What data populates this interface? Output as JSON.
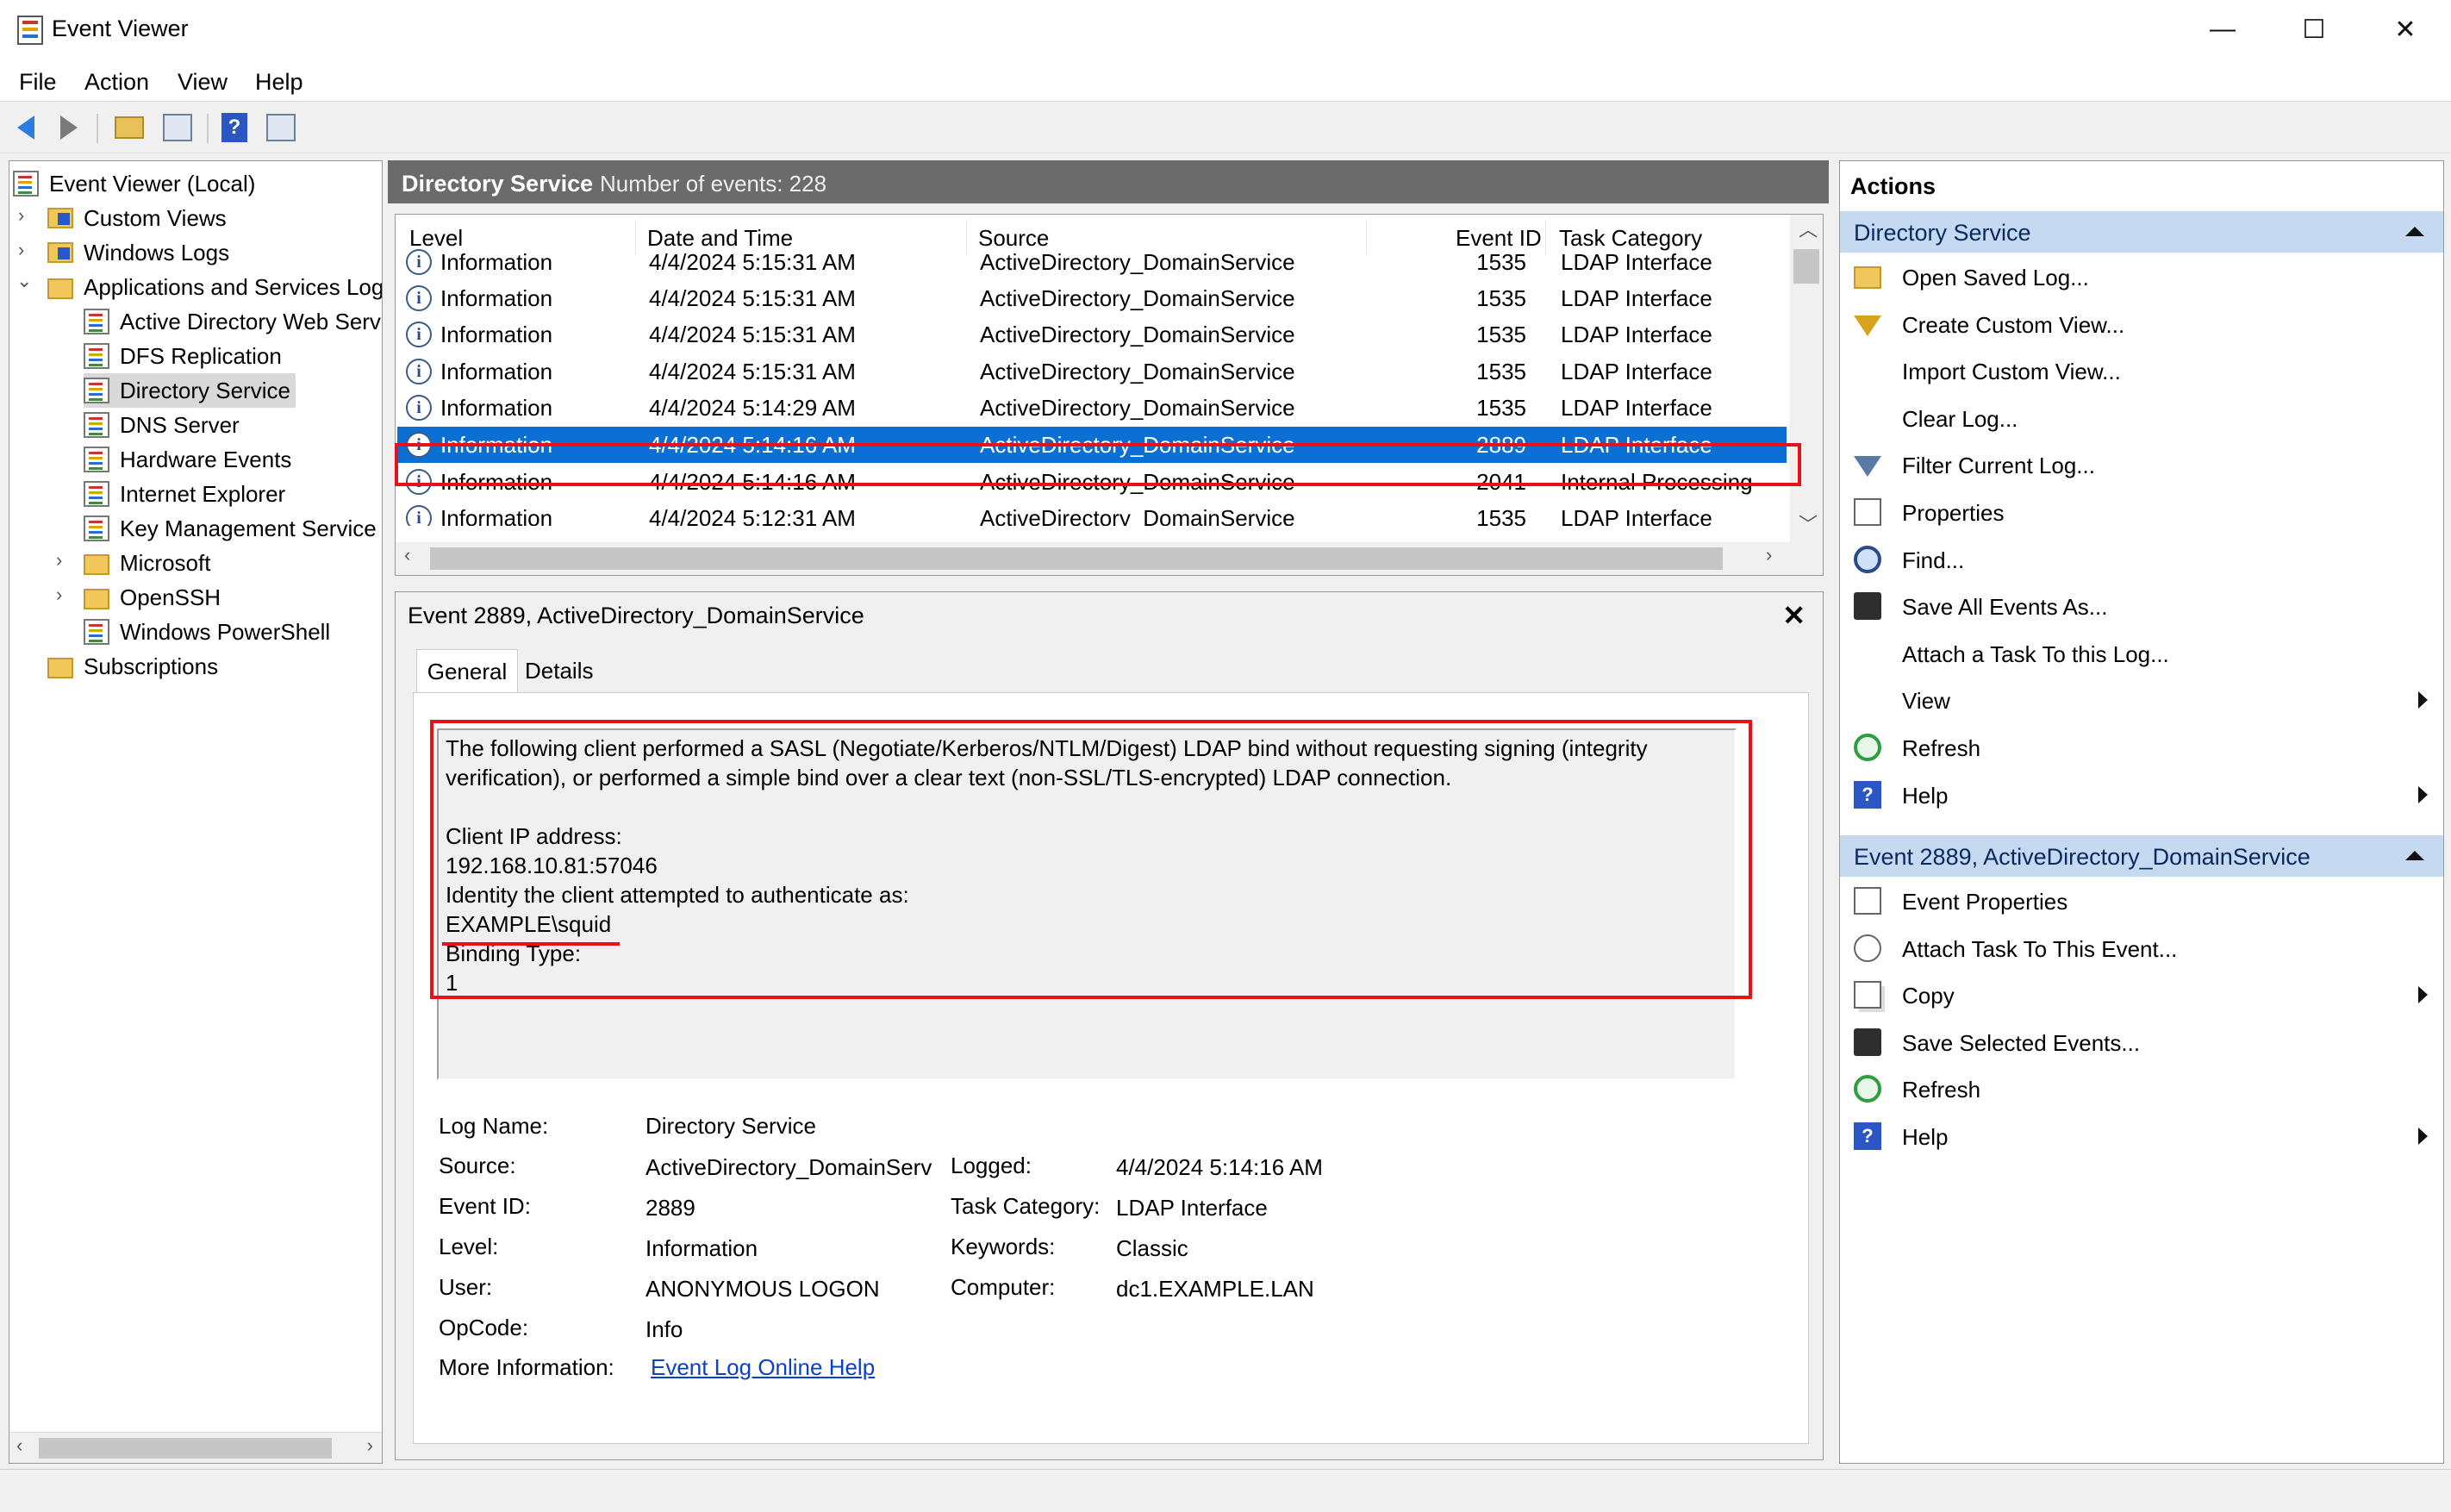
{
  "window": {
    "title": "Event Viewer",
    "minimize": "—",
    "maximize": "☐",
    "close": "✕"
  },
  "menu": [
    "File",
    "Action",
    "View",
    "Help"
  ],
  "tree": [
    {
      "label": "Event Viewer (Local)",
      "icon": "log-icon",
      "indent": 0,
      "expander": ""
    },
    {
      "label": "Custom Views",
      "icon": "folder-icon",
      "indent": 1,
      "expander": "›"
    },
    {
      "label": "Windows Logs",
      "icon": "folder-icon",
      "indent": 1,
      "expander": "›"
    },
    {
      "label": "Applications and Services Logs",
      "icon": "folder-icon",
      "indent": 1,
      "expander": "⌄"
    },
    {
      "label": "Active Directory Web Services",
      "icon": "log-icon",
      "indent": 2,
      "expander": ""
    },
    {
      "label": "DFS Replication",
      "icon": "log-icon",
      "indent": 2,
      "expander": ""
    },
    {
      "label": "Directory Service",
      "icon": "log-icon",
      "indent": 2,
      "expander": "",
      "selected": true
    },
    {
      "label": "DNS Server",
      "icon": "log-icon",
      "indent": 2,
      "expander": ""
    },
    {
      "label": "Hardware Events",
      "icon": "log-icon",
      "indent": 2,
      "expander": ""
    },
    {
      "label": "Internet Explorer",
      "icon": "log-icon",
      "indent": 2,
      "expander": ""
    },
    {
      "label": "Key Management Service",
      "icon": "log-icon",
      "indent": 2,
      "expander": ""
    },
    {
      "label": "Microsoft",
      "icon": "folder-icon",
      "indent": 2,
      "expander": "›"
    },
    {
      "label": "OpenSSH",
      "icon": "folder-icon",
      "indent": 2,
      "expander": "›"
    },
    {
      "label": "Windows PowerShell",
      "icon": "log-icon",
      "indent": 2,
      "expander": ""
    },
    {
      "label": "Subscriptions",
      "icon": "folder-icon",
      "indent": 1,
      "expander": ""
    }
  ],
  "list": {
    "title": "Directory Service",
    "count": "Number of events: 228",
    "columns": [
      "Level",
      "Date and Time",
      "Source",
      "Event ID",
      "Task Category"
    ],
    "rows": [
      [
        "Information",
        "4/4/2024 5:15:31 AM",
        "ActiveDirectory_DomainService",
        "1535",
        "LDAP Interface"
      ],
      [
        "Information",
        "4/4/2024 5:15:31 AM",
        "ActiveDirectory_DomainService",
        "1535",
        "LDAP Interface"
      ],
      [
        "Information",
        "4/4/2024 5:15:31 AM",
        "ActiveDirectory_DomainService",
        "1535",
        "LDAP Interface"
      ],
      [
        "Information",
        "4/4/2024 5:15:31 AM",
        "ActiveDirectory_DomainService",
        "1535",
        "LDAP Interface"
      ],
      [
        "Information",
        "4/4/2024 5:14:29 AM",
        "ActiveDirectory_DomainService",
        "1535",
        "LDAP Interface"
      ],
      [
        "Information",
        "4/4/2024 5:14:16 AM",
        "ActiveDirectory_DomainService",
        "2889",
        "LDAP Interface"
      ],
      [
        "Information",
        "4/4/2024 5:14:16 AM",
        "ActiveDirectory_DomainService",
        "2041",
        "Internal Processing"
      ],
      [
        "Information",
        "4/4/2024 5:12:31 AM",
        "ActiveDirectory_DomainService",
        "1535",
        "LDAP Interface"
      ]
    ],
    "selected_row": 5
  },
  "detail": {
    "title": "Event 2889, ActiveDirectory_DomainService",
    "tabs": [
      "General",
      "Details"
    ],
    "message": "The following client performed a SASL (Negotiate/Kerberos/NTLM/Digest) LDAP bind without requesting signing (integrity\nverification), or performed a simple bind over a clear text (non-SSL/TLS-encrypted) LDAP connection.\n\nClient IP address:\n192.168.10.81:57046\nIdentity the client attempted to authenticate as:\nEXAMPLE\\squid\nBinding Type:\n1",
    "fields": {
      "log_name_label": "Log Name:",
      "log_name": "Directory Service",
      "source_label": "Source:",
      "source": "ActiveDirectory_DomainServic",
      "logged_label": "Logged:",
      "logged": "4/4/2024 5:14:16 AM",
      "event_id_label": "Event ID:",
      "event_id": "2889",
      "task_label": "Task Category:",
      "task": "LDAP Interface",
      "level_label": "Level:",
      "level": "Information",
      "keywords_label": "Keywords:",
      "keywords": "Classic",
      "user_label": "User:",
      "user": "ANONYMOUS LOGON",
      "computer_label": "Computer:",
      "computer": "dc1.EXAMPLE.LAN",
      "opcode_label": "OpCode:",
      "opcode": "Info",
      "more_label": "More Information:",
      "more_link": "Event Log Online Help"
    }
  },
  "actions": {
    "title": "Actions",
    "section1": "Directory Service",
    "items1": [
      {
        "label": "Open Saved Log...",
        "icon": "open-folder-icon",
        "submenu": false
      },
      {
        "label": "Create Custom View...",
        "icon": "filter-icon",
        "submenu": false
      },
      {
        "label": "Import Custom View...",
        "icon": "",
        "submenu": false
      },
      {
        "label": "Clear Log...",
        "icon": "",
        "submenu": false
      },
      {
        "label": "Filter Current Log...",
        "icon": "filter-icon",
        "submenu": false
      },
      {
        "label": "Properties",
        "icon": "properties-icon",
        "submenu": false
      },
      {
        "label": "Find...",
        "icon": "binoculars-icon",
        "submenu": false
      },
      {
        "label": "Save All Events As...",
        "icon": "save-icon",
        "submenu": false
      },
      {
        "label": "Attach a Task To this Log...",
        "icon": "",
        "submenu": false
      },
      {
        "label": "View",
        "icon": "",
        "submenu": true
      },
      {
        "label": "Refresh",
        "icon": "refresh-icon",
        "submenu": false
      },
      {
        "label": "Help",
        "icon": "help-icon",
        "submenu": true
      }
    ],
    "section2": "Event 2889, ActiveDirectory_DomainService",
    "items2": [
      {
        "label": "Event Properties",
        "icon": "properties-icon",
        "submenu": false
      },
      {
        "label": "Attach Task To This Event...",
        "icon": "task-icon",
        "submenu": false
      },
      {
        "label": "Copy",
        "icon": "copy-icon",
        "submenu": true
      },
      {
        "label": "Save Selected Events...",
        "icon": "save-icon",
        "submenu": false
      },
      {
        "label": "Refresh",
        "icon": "refresh-icon",
        "submenu": false
      },
      {
        "label": "Help",
        "icon": "help-icon",
        "submenu": true
      }
    ]
  },
  "colors": {
    "selection": "#0b6fd4",
    "highlight_box": "#e8111b",
    "section_header": "#c5daf1",
    "link": "#0b40c8"
  }
}
